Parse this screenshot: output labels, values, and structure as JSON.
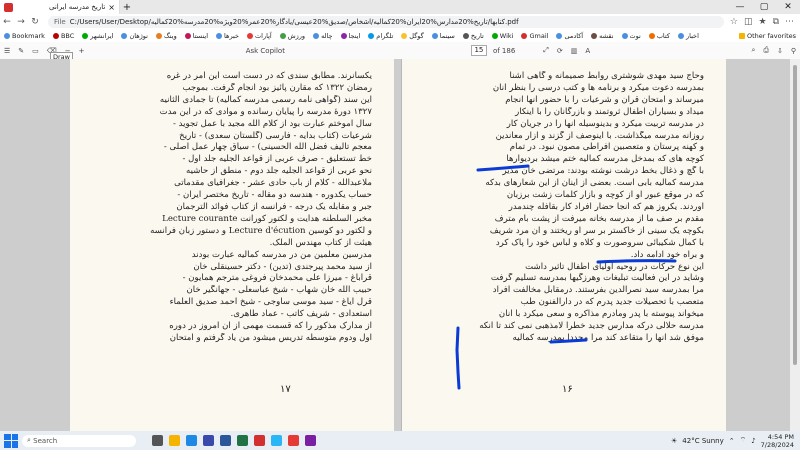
{
  "tab": {
    "title": "تاریخ مدرسه ایرانی",
    "close": "×",
    "new": "+"
  },
  "window": {
    "min": "—",
    "max": "▢",
    "close": "✕"
  },
  "address": {
    "file_label": "File",
    "url": "C:/Users/User/Desktop/کتابها/تاریخ%20مدارس%20ایران%20کمالیه/اشخاص/صدیق%20عیسی/یادگار%20عمر%20ویژه%20مدرسه%20کمالیه.pdf"
  },
  "bookmarks": [
    "Bookmark",
    "BBC",
    "ایرانشهر",
    "نوژهان",
    "وینگ",
    "اینستا",
    "خبرها",
    "آپارات",
    "ورزش",
    "چاله",
    "اینجا",
    "تلگرام",
    "گوگل",
    "سینما",
    "تاریخ",
    "Wiki",
    "Gmail",
    "آکادمی",
    "نقشه",
    "نوت",
    "کتاب",
    "اخبار"
  ],
  "other_favorites": "Other favorites",
  "pdf_toolbar": {
    "draw_tooltip": "Draw",
    "page_current": "15",
    "page_total": "of 186",
    "ask_copilot": "Ask Copilot"
  },
  "left_page": {
    "lines": [
      "یکسانرند. مطابق سندی که در دست است این امر در غره",
      "رمضان ۱۳۲۲ که مقارن پائیز بود انجام گرفت. بموجب",
      "این سند (گواهی نامه رسمی مدرسه کمالیه) تا جمادی الثانیه",
      "۱۳۲۷ دورهٔ مدرسه را پیایان رسانده و موادی که در این مدت",
      "سال آموختم عبارت بود از کلام الله مجید با عمل تجوید -",
      "شرعیات (کتاب بدایه - فارسی (گلستان سعدی) - تاریخ",
      "معجم تألیف فضل الله الحسینی) - سیاق چهار عمل اصلی -",
      "خط تستعلیق - صرف عربی از قواعد الجلیه جلد اول -",
      "نحو عربی از قواعد الجلیه جلد دوم - منطق از حاشیه",
      "ملاعبدالله - کلام از باب حادی عشر - جغرافیای مقدماتی",
      "حساب یکدوره - هندسه دو مقاله - تاریخ مختصر ایران -",
      "جبر و مقابله یک درجه - فرانسه از کتاب فوائد الترجمان",
      "مخبر السلطنه هدایت و لکتور کورانت Lecture courante",
      "و لکتور دو کوسین Lecture d'écution و دستور زبان فرانسه",
      "هیئت از کتاب مهندس الملک.",
      "مدرسین معلمین من در مدرسه کمالیه عبارت بودند",
      "از سید محمد پیرجندی (تدین) - دکتر حسینقلی خان",
      "قراباغ - میرزا علی محمدخان فروغی مترجم همایون -",
      "حبیب الله خان شهاب - شیخ عباسعلی - جهانگیر خان",
      "قرل ایاغ - سید موسی ساوجی - شیخ احمد صدیق العلماء",
      "استعدادی - شریف کاتب - عماد طاهری.",
      "از مدارک مذکور را که قسمت مهمی از آن امروز در دوره",
      "اول ودوم متوسطه تدریس میشود من یاد گرفتم و امتحان"
    ],
    "page_number": "۱۷"
  },
  "right_page": {
    "lines": [
      "وحاج سید مهدی شوشتری روابط صمیمانه و گاهی آشنا",
      "بمدرسه دعوت میکرد و برنامه ها و کتب درسی را بنظر آنان",
      "میرساند و امتحان قرآن و شرعیات را با حضور آنها انجام",
      "میداد و بسیاران اطفال ثروتمند و بازرگانان را با اینکار",
      "در مدرسه تربیت میکرد و بدینوسیله آنها را در جریان کار",
      "روزانه مدرسه میگذاشت. با اینوصف از گزند و آزار معاندین",
      "و کهنه پرستان و متعصبین افراطی مصون نبود. در تمام",
      "کوچه های که بمدخل مدرسه کمالیه ختم میشد بردیوارها",
      "با گچ و ذغال بخط درشت نوشته بودند: مرتضی خان مدیر",
      "مدرسه کمالیه بابی است. بعضی از اینان از این شعارهای بدکه",
      "که در موقع عبور او از کوچه و بازار کلمات زشت برزبان",
      "آوردند. یکروز هم که آنجا حضار افراد کار بقافله چندمدر",
      "مقدم بر صف ما از مدرسه بخانه میرفت از پشت بام مترف",
      "بکوچه یک سینی از خاکستر بر سر او ریختند و آن مرد شریف",
      "با کمال شکیبائی سروصورت و کلاه و لباس خود را پاک کرد",
      "و براه خود ادامه داد.",
      "این نوع حرکات در روحیه اولیای اطفال تأثیر داشت",
      "وشاید در این فعالیت تبلیغات وهرزگیها بمدرسه تسلیم گرفت",
      "مرا بمدرسه سید نصرالدین بفرستند. درمقابل مخالفت افراد",
      "متعصب با تحصیلات جدید پدرم که در دارالفنون طب",
      "میخواند پیوسته با پدر ومادرم مذاکره و سعی میکرد با آنان",
      "مدرسه حلالی درکه مدارس جدید خطرا لامذهبی نمی کند تا آنکه",
      "موفق شد آنها را متقاعد کند مرا مجدداً بمدرسه کمالیه"
    ],
    "page_number": "۱۶"
  },
  "taskbar": {
    "search_placeholder": "Search",
    "weather": "42°C Sunny",
    "time": "4:54 PM",
    "date": "7/28/2024"
  }
}
